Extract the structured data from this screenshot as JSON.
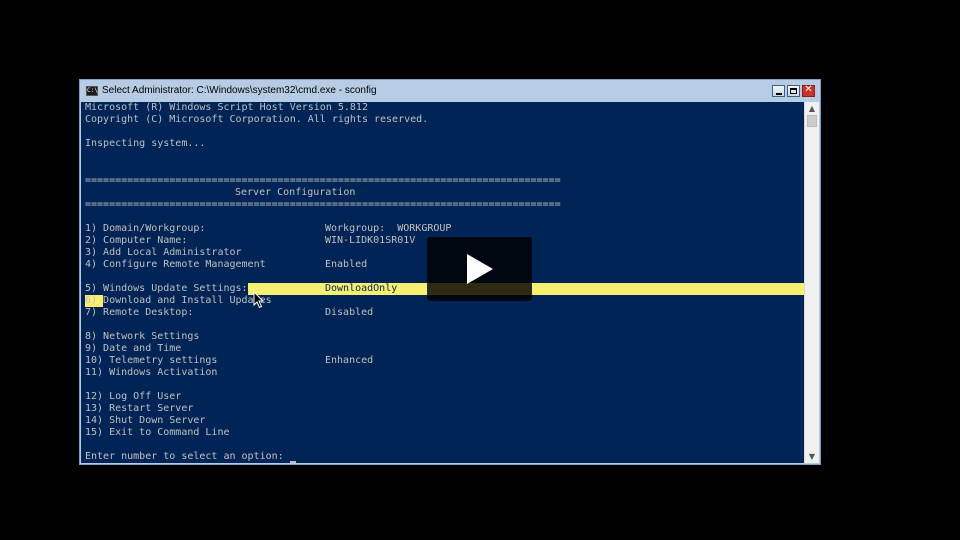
{
  "window": {
    "title": "Select Administrator: C:\\Windows\\system32\\cmd.exe - sconfig",
    "icon": "cmd-icon",
    "icon_text": "C:\\"
  },
  "console": {
    "header": [
      "Microsoft (R) Windows Script Host Version 5.812",
      "Copyright (C) Microsoft Corporation. All rights reserved."
    ],
    "inspecting": "Inspecting system...",
    "separator": "===============================================================================",
    "section_title": "Server Configuration",
    "menu": [
      {
        "label": "1) Domain/Workgroup:",
        "value": "Workgroup:  WORKGROUP"
      },
      {
        "label": "2) Computer Name:",
        "value": "WIN-LIDK01SR01V"
      },
      {
        "label": "3) Add Local Administrator",
        "value": ""
      },
      {
        "label": "4) Configure Remote Management",
        "value": "Enabled"
      },
      {
        "label": "5) Windows Update Settings:",
        "value": "DownloadOnly"
      },
      {
        "label": "6) Download and Install Updates",
        "value": ""
      },
      {
        "label": "7) Remote Desktop:",
        "value": "Disabled"
      },
      {
        "label": "8) Network Settings",
        "value": ""
      },
      {
        "label": "9) Date and Time",
        "value": ""
      },
      {
        "label": "10) Telemetry settings",
        "value": "Enhanced"
      },
      {
        "label": "11) Windows Activation",
        "value": ""
      },
      {
        "label": "12) Log Off User",
        "value": ""
      },
      {
        "label": "13) Restart Server",
        "value": ""
      },
      {
        "label": "14) Shut Down Server",
        "value": ""
      },
      {
        "label": "15) Exit to Command Line",
        "value": ""
      }
    ],
    "prompt": "Enter number to select an option:",
    "colors": {
      "background": "#012456",
      "text": "#c0c0c0",
      "highlight": "#f7ef70"
    }
  },
  "video": {
    "play_icon": "play-icon"
  }
}
